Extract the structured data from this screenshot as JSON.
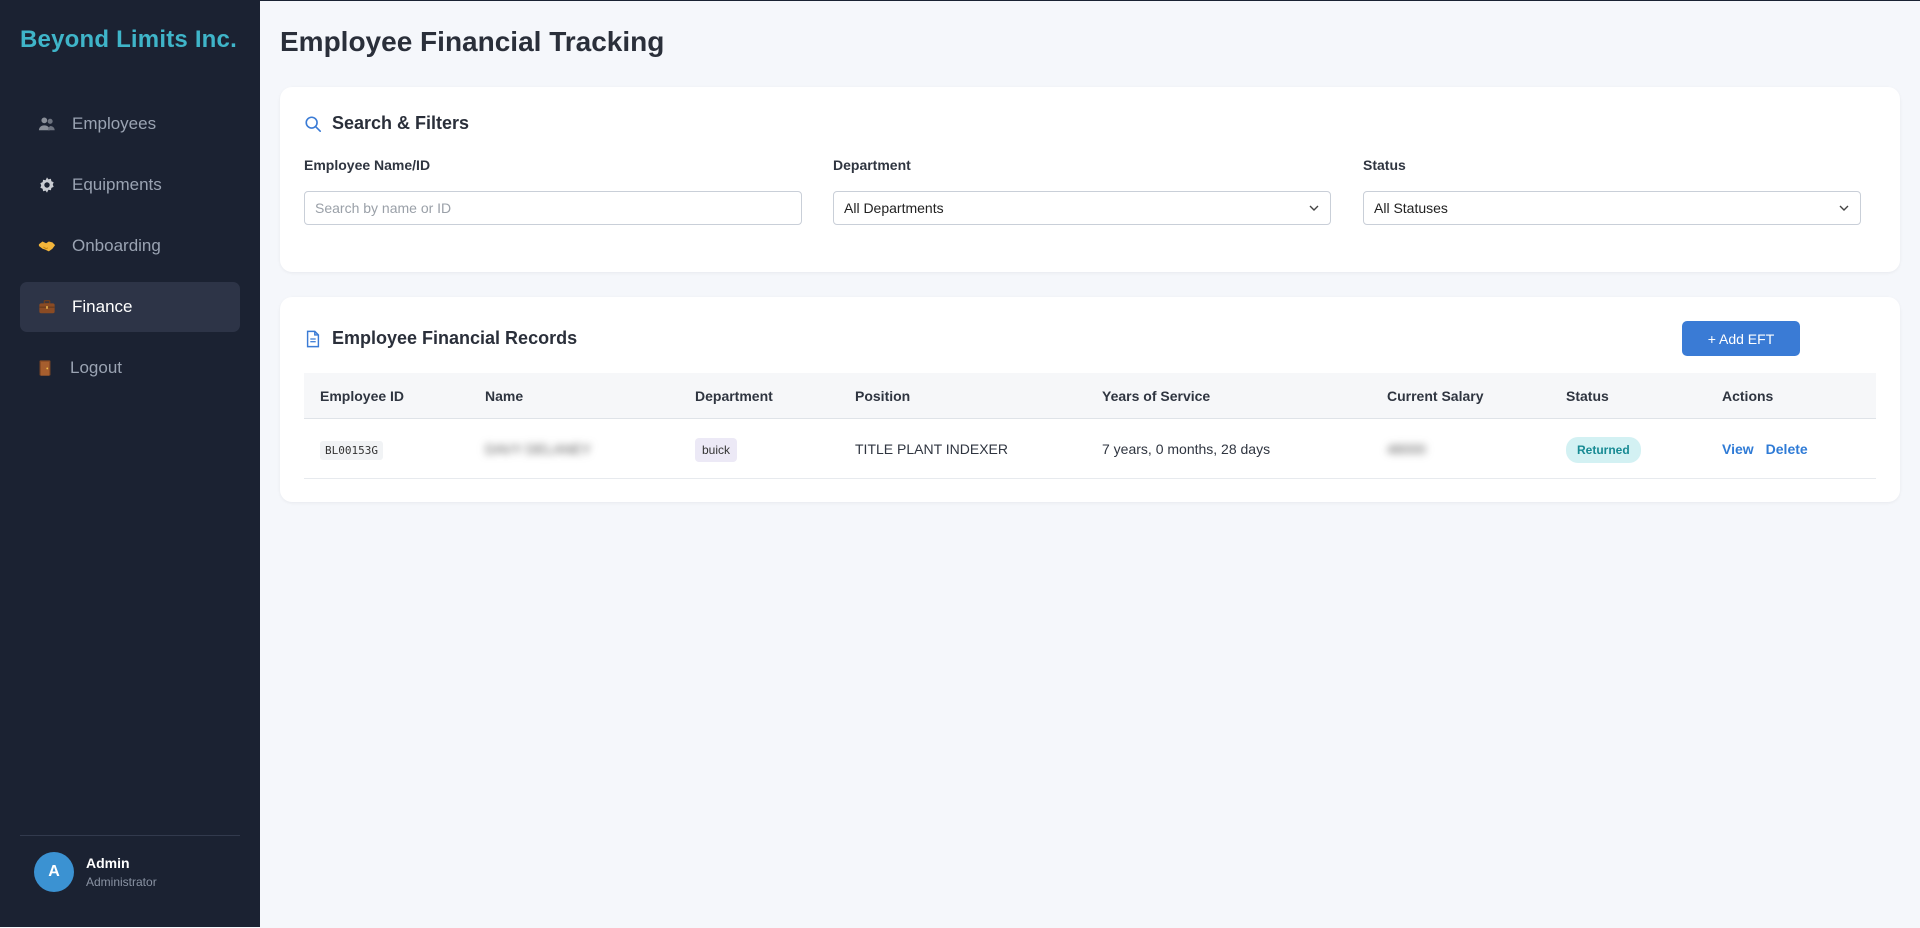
{
  "brand": "Beyond Limits Inc.",
  "nav": [
    {
      "label": "Employees",
      "icon": "people-icon"
    },
    {
      "label": "Equipments",
      "icon": "gear-icon"
    },
    {
      "label": "Onboarding",
      "icon": "handshake-icon"
    },
    {
      "label": "Finance",
      "icon": "briefcase-icon",
      "active": true
    },
    {
      "label": "Logout",
      "icon": "door-icon"
    }
  ],
  "user": {
    "initial": "A",
    "name": "Admin",
    "role": "Administrator"
  },
  "page": {
    "title": "Employee Financial Tracking"
  },
  "filters": {
    "title": "Search & Filters",
    "name_label": "Employee Name/ID",
    "name_placeholder": "Search by name or ID",
    "dept_label": "Department",
    "dept_value": "All Departments",
    "status_label": "Status",
    "status_value": "All Statuses"
  },
  "records": {
    "title": "Employee Financial Records",
    "add_label": "+ Add EFT",
    "columns": [
      "Employee ID",
      "Name",
      "Department",
      "Position",
      "Years of Service",
      "Current Salary",
      "Status",
      "Actions"
    ],
    "rows": [
      {
        "id": "BL00153G",
        "name": "DAVY DELANEY",
        "department": "buick",
        "position": "TITLE PLANT INDEXER",
        "years": "7 years, 0 months, 28 days",
        "salary": "48000",
        "status": "Returned",
        "view": "View",
        "delete": "Delete"
      }
    ]
  },
  "colors": {
    "sidebar_bg": "#1b2232",
    "brand": "#3fb5c9",
    "accent": "#3a7bd5",
    "status_returned_bg": "#d3f1f3",
    "status_returned_text": "#178a93"
  }
}
